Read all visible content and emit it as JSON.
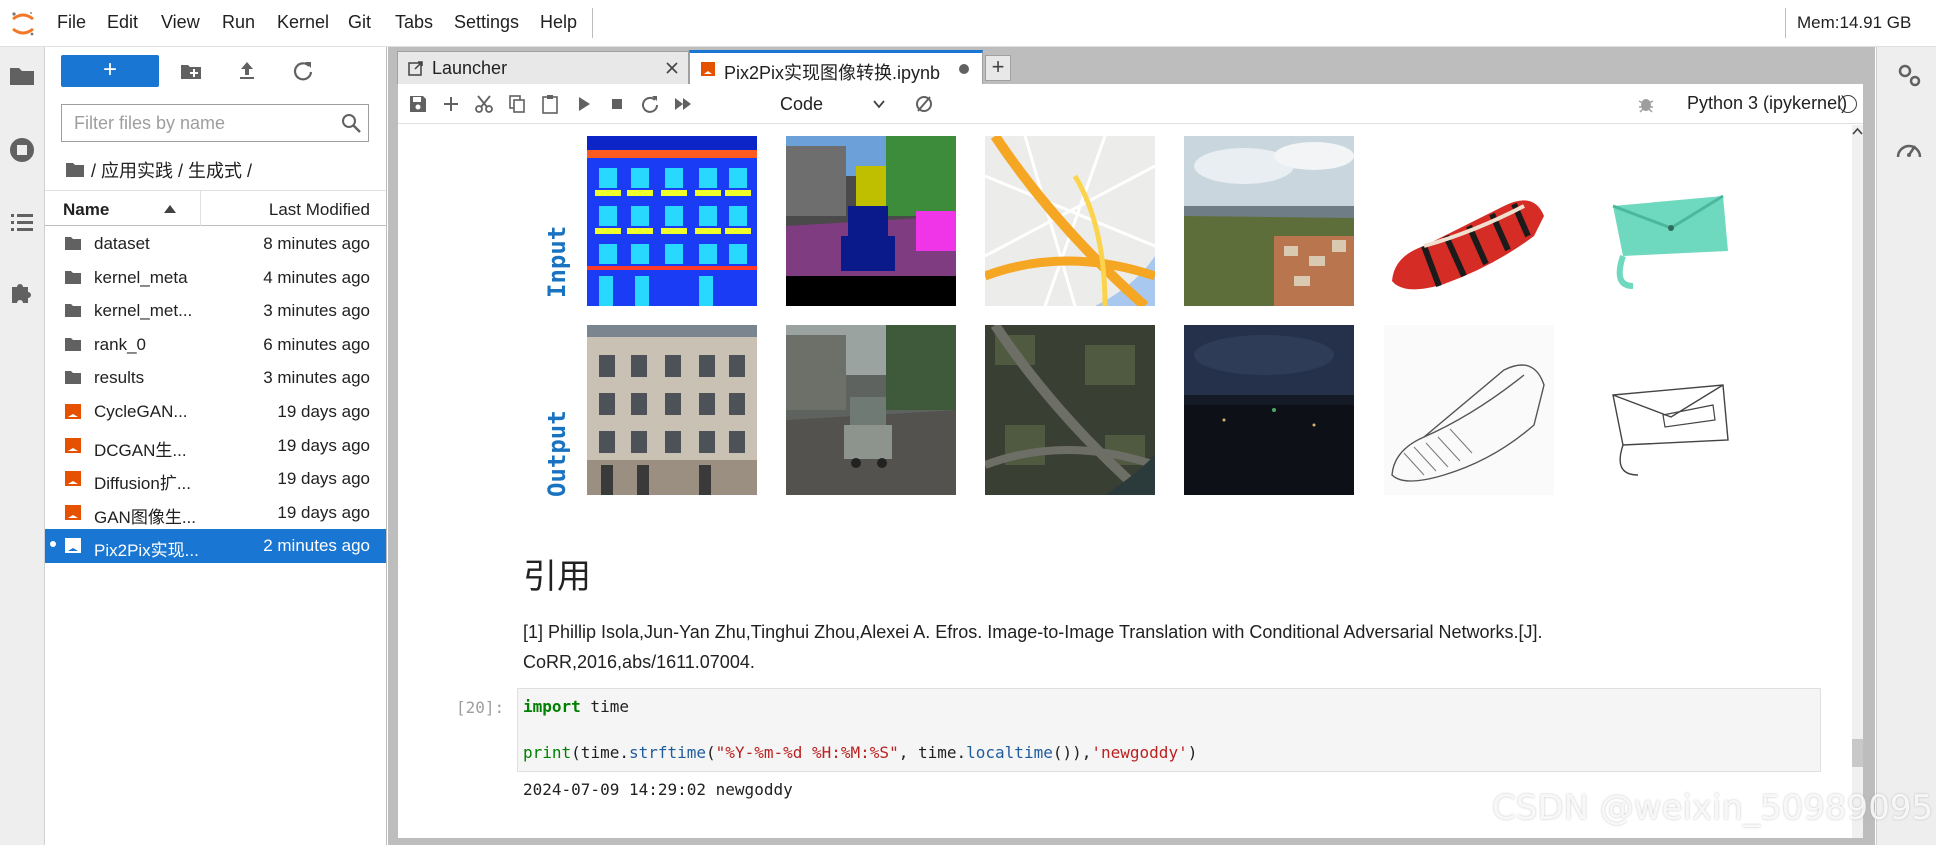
{
  "menubar": {
    "items": [
      "File",
      "Edit",
      "View",
      "Run",
      "Kernel",
      "Git",
      "Tabs",
      "Settings",
      "Help"
    ],
    "memory": "Mem:14.91 GB"
  },
  "file_browser": {
    "new_button_label": "+",
    "filter_placeholder": "Filter files by name",
    "breadcrumb": "/ 应用实践 / 生成式 /",
    "columns": {
      "name": "Name",
      "modified": "Last Modified"
    },
    "files": [
      {
        "name": "dataset",
        "modified": "8 minutes ago",
        "type": "folder"
      },
      {
        "name": "kernel_meta",
        "modified": "4 minutes ago",
        "type": "folder"
      },
      {
        "name": "kernel_met...",
        "modified": "3 minutes ago",
        "type": "folder"
      },
      {
        "name": "rank_0",
        "modified": "6 minutes ago",
        "type": "folder"
      },
      {
        "name": "results",
        "modified": "3 minutes ago",
        "type": "folder"
      },
      {
        "name": "CycleGAN...",
        "modified": "19 days ago",
        "type": "notebook"
      },
      {
        "name": "DCGAN生...",
        "modified": "19 days ago",
        "type": "notebook"
      },
      {
        "name": "Diffusion扩...",
        "modified": "19 days ago",
        "type": "notebook"
      },
      {
        "name": "GAN图像生...",
        "modified": "19 days ago",
        "type": "notebook"
      },
      {
        "name": "Pix2Pix实现...",
        "modified": "2 minutes ago",
        "type": "notebook",
        "selected": true
      }
    ]
  },
  "tabs": [
    {
      "label": "Launcher",
      "icon": "launcher-icon",
      "active": false
    },
    {
      "label": "Pix2Pix实现图像转换.ipynb",
      "icon": "notebook-icon",
      "active": true
    }
  ],
  "notebook_toolbar": {
    "cell_type": "Code",
    "kernel": "Python 3 (ipykernel)"
  },
  "notebook": {
    "figure": {
      "row_labels": [
        "Input",
        "Output"
      ]
    },
    "reference_heading": "引用",
    "reference_text": "[1] Phillip Isola,Jun-Yan Zhu,Tinghui Zhou,Alexei A. Efros. Image-to-Image Translation with Conditional Adversarial Networks.[J]. CoRR,2016,abs/1611.07004.",
    "cell": {
      "prompt": "[20]:",
      "line1_kw": "import",
      "line1_rest": " time",
      "line2_print": "print",
      "line2_a": "(time.",
      "line2_fn1": "strftime",
      "line2_b": "(",
      "line2_str1": "\"%Y-%m-%d %H:%M:%S\"",
      "line2_c": ", time.",
      "line2_fn2": "localtime",
      "line2_d": "()),",
      "line2_str2": "'newgoddy'",
      "line2_e": ")",
      "output": "2024-07-09 14:29:02 newgoddy"
    }
  },
  "watermark": "CSDN @weixin_50989095",
  "colors": {
    "accent": "#1976d2",
    "notebook_orange": "#e65100",
    "label_blue": "#1a73c0"
  }
}
